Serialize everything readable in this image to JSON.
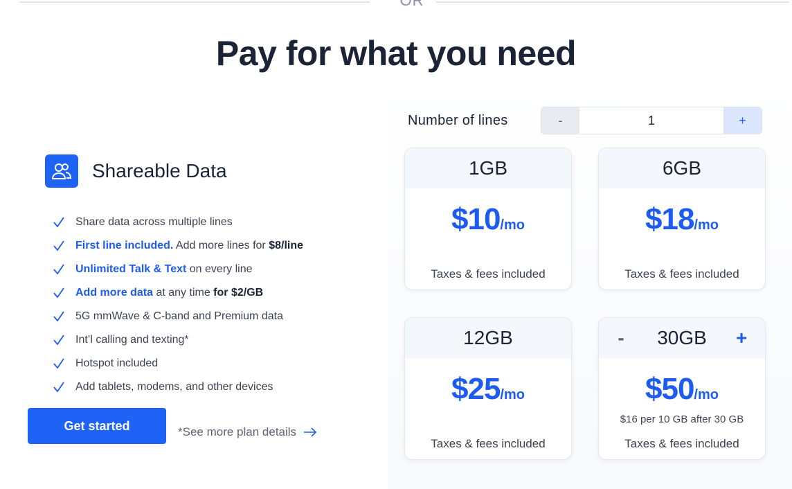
{
  "divider": {
    "text": "OR"
  },
  "headline": "Pay for what you need",
  "feature": {
    "title": "Shareable Data",
    "icon": "users-icon",
    "accent_color": "#1e63f5",
    "items": [
      {
        "parts": [
          {
            "text": "Share data across multiple lines",
            "style": "normal"
          }
        ]
      },
      {
        "parts": [
          {
            "text": "First line included.",
            "style": "hl"
          },
          {
            "text": " Add more lines for ",
            "style": "normal"
          },
          {
            "text": "$8/line",
            "style": "strong"
          }
        ]
      },
      {
        "parts": [
          {
            "text": "Unlimited Talk & Text",
            "style": "hl"
          },
          {
            "text": " on every line",
            "style": "normal"
          }
        ]
      },
      {
        "parts": [
          {
            "text": "Add more data",
            "style": "hl"
          },
          {
            "text": " at any time ",
            "style": "normal"
          },
          {
            "text": "for $2/GB",
            "style": "strong"
          }
        ]
      },
      {
        "parts": [
          {
            "text": "5G mmWave & C-band and Premium data",
            "style": "normal"
          }
        ]
      },
      {
        "parts": [
          {
            "text": "Int’l calling and texting*",
            "style": "normal"
          }
        ]
      },
      {
        "parts": [
          {
            "text": "Hotspot included",
            "style": "normal"
          }
        ]
      },
      {
        "parts": [
          {
            "text": "Add tablets, modems, and other devices",
            "style": "normal"
          }
        ]
      }
    ],
    "cta_label": "Get started",
    "details_label": "*See more plan details"
  },
  "lines": {
    "label": "Number of lines",
    "minus": "-",
    "value": "1",
    "plus": "+"
  },
  "plans": [
    {
      "name": "1GB",
      "price": "$10",
      "per": "/mo",
      "note": "",
      "tax": "Taxes & fees included",
      "adjustable": false
    },
    {
      "name": "6GB",
      "price": "$18",
      "per": "/mo",
      "note": "",
      "tax": "Taxes & fees included",
      "adjustable": false
    },
    {
      "name": "12GB",
      "price": "$25",
      "per": "/mo",
      "note": "",
      "tax": "Taxes & fees included",
      "adjustable": false
    },
    {
      "name": "30GB",
      "price": "$50",
      "per": "/mo",
      "note": "$16 per 10 GB after 30 GB",
      "tax": "Taxes & fees included",
      "adjustable": true,
      "minus": "-",
      "plus": "+"
    }
  ]
}
